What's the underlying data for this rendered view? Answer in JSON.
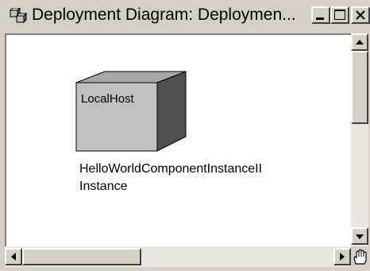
{
  "window": {
    "title": "Deployment Diagram: Deploymen...",
    "buttons": [
      "minimize",
      "maximize",
      "close"
    ]
  },
  "diagram": {
    "node": {
      "type": "node",
      "label": "LocalHost"
    },
    "caption_lines": [
      "HelloWorldComponentInstanceII",
      "Instance"
    ]
  },
  "icons": {
    "app": "deployment-diagram-icon",
    "scroll_up": "arrow-up-icon",
    "scroll_down": "arrow-down-icon",
    "scroll_left": "arrow-left-icon",
    "scroll_right": "arrow-right-icon",
    "corner": "hand-pan-icon"
  },
  "colors": {
    "node_front": "#c0c0c0",
    "node_top": "#a8a8a8",
    "node_side": "#505050",
    "canvas": "#ffffff",
    "chrome": "#d4d0c8"
  }
}
